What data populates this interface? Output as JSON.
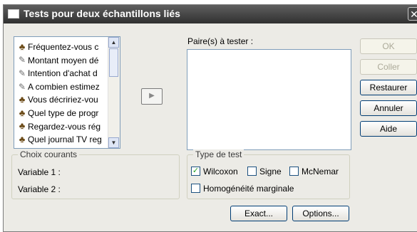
{
  "window": {
    "title": "Tests pour deux échantillons liés",
    "close_glyph": "✕"
  },
  "variables": {
    "items": [
      {
        "label": "Fréquentez-vous c",
        "icon": "nominal-icon"
      },
      {
        "label": "Montant moyen dé",
        "icon": "scale-icon"
      },
      {
        "label": "Intention d'achat d",
        "icon": "scale-icon"
      },
      {
        "label": "A combien estimez",
        "icon": "scale-icon"
      },
      {
        "label": "Vous décririez-vou",
        "icon": "nominal-icon"
      },
      {
        "label": "Quel type de progr",
        "icon": "nominal-icon"
      },
      {
        "label": "Regardez-vous rég",
        "icon": "nominal-icon"
      },
      {
        "label": "Quel journal TV reg",
        "icon": "nominal-icon"
      }
    ]
  },
  "pairs": {
    "label": "Paire(s) à tester :"
  },
  "move_button": {
    "glyph": "▶"
  },
  "buttons": {
    "ok": "OK",
    "paste": "Coller",
    "reset": "Restaurer",
    "cancel": "Annuler",
    "help": "Aide",
    "exact": "Exact...",
    "options": "Options..."
  },
  "current_choice": {
    "title": "Choix courants",
    "variable1": "Variable 1 :",
    "variable2": "Variable 2 :"
  },
  "test_type": {
    "title": "Type de test",
    "wilcoxon": {
      "label": "Wilcoxon",
      "checked": true
    },
    "sign": {
      "label": "Signe",
      "checked": false
    },
    "mcnemar": {
      "label": "McNemar",
      "checked": false
    },
    "marginal": {
      "label": "Homogénéité marginale",
      "checked": false
    }
  }
}
